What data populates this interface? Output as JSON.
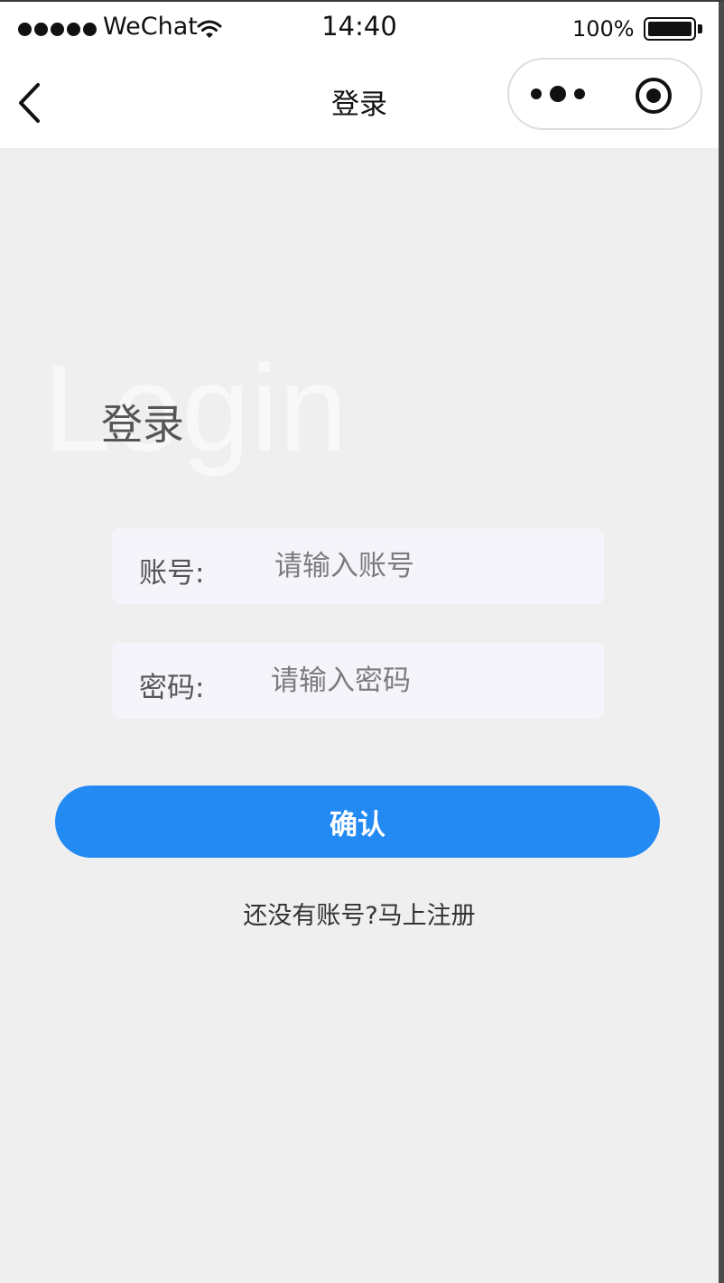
{
  "status_bar": {
    "carrier": "WeChat",
    "time": "14:40",
    "battery": "100%"
  },
  "nav": {
    "title": "登录"
  },
  "page": {
    "background_text": "Login",
    "title": "登录",
    "account": {
      "label": "账号:",
      "placeholder": "请输入账号",
      "value": ""
    },
    "password": {
      "label": "密码:",
      "placeholder": "请输入密码",
      "value": ""
    },
    "confirm_label": "确认",
    "register_link": "还没有账号?马上注册"
  },
  "colors": {
    "primary": "#238af4",
    "page_background": "#efefef",
    "input_background": "#f5f4fa"
  },
  "icons": [
    "signal-icon",
    "wifi-icon",
    "battery-icon",
    "back-arrow-icon",
    "more-dots-icon",
    "close-target-icon"
  ]
}
